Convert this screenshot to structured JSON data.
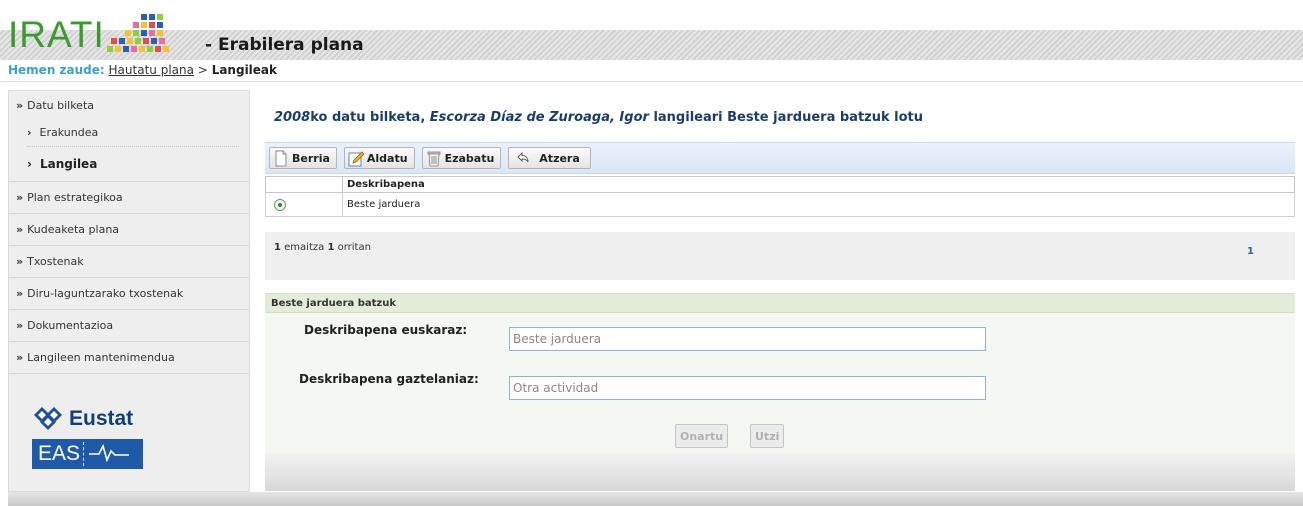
{
  "header": {
    "logo_text": "IRATI",
    "title": "- Erabilera plana"
  },
  "breadcrumb": {
    "label": "Hemen zaude:",
    "link": "Hautatu plana",
    "separator": ">",
    "current": "Langileak"
  },
  "sidebar": {
    "items": [
      {
        "label": "Datu bilketa"
      },
      {
        "label": "Plan estrategikoa"
      },
      {
        "label": "Kudeaketa plana"
      },
      {
        "label": "Txostenak"
      },
      {
        "label": "Diru-laguntzarako txostenak"
      },
      {
        "label": "Dokumentazioa"
      },
      {
        "label": "Langileen mantenimendua"
      }
    ],
    "sub_items": [
      {
        "label": "Erakundea"
      },
      {
        "label": "Langilea"
      }
    ],
    "logos": {
      "eustat": "Eustat",
      "eas": "EAS"
    }
  },
  "main": {
    "title_year": "2008",
    "title_part1": "ko datu bilketa, ",
    "title_person": "Escorza Díaz de Zuroaga, Igor",
    "title_part2": " langileari Beste jarduera batzuk lotu",
    "toolbar": {
      "new": "Berria",
      "edit": "Aldatu",
      "delete": "Ezabatu",
      "back": "Atzera"
    },
    "table": {
      "columns": [
        "",
        "Deskribapena"
      ],
      "rows": [
        {
          "description": "Beste jarduera"
        }
      ]
    },
    "pager": {
      "count": "1",
      "text1": " emaitza ",
      "pages": "1",
      "text2": " orritan",
      "current_page": "1"
    },
    "form": {
      "header": "Beste jarduera batzuk",
      "label_eu": "Deskribapena euskaraz:",
      "value_eu": "Beste jarduera",
      "label_es": "Deskribapena gaztelaniaz:",
      "value_es": "Otra actividad",
      "ok": "Onartu",
      "cancel": "Utzi"
    }
  },
  "colors": {
    "logo_green": "#3b9a2e",
    "breadcrumb_label": "#3aa0cf",
    "title_blue": "#1b3d6b",
    "toolbar_bg": "#dbe7f6",
    "form_header_bg": "#e3ecd8",
    "pager_link": "#2a62b3"
  }
}
